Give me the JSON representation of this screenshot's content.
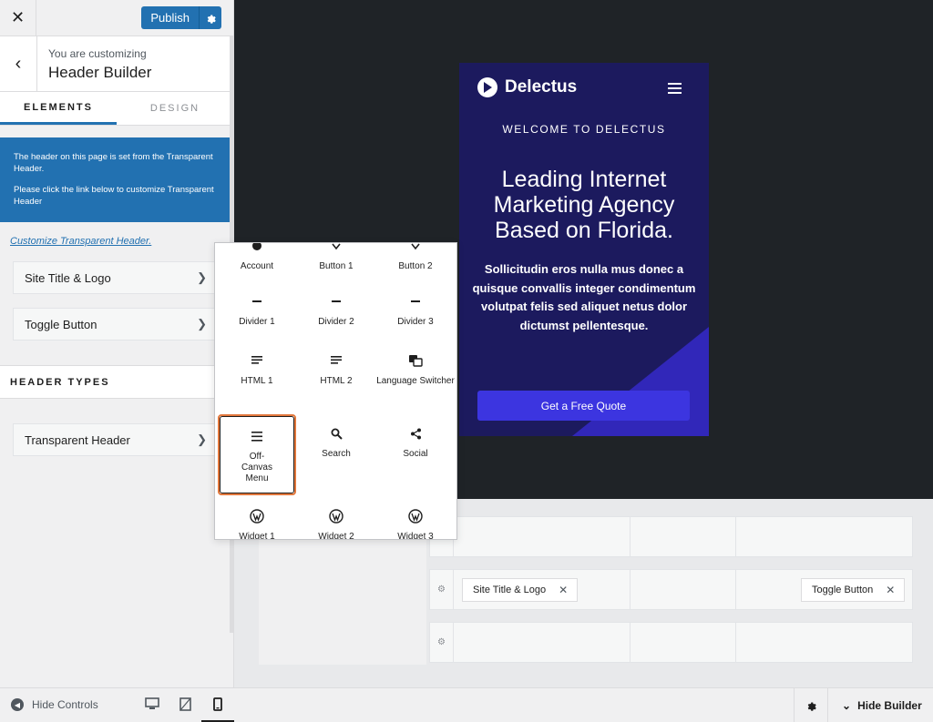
{
  "sidebar": {
    "publish_label": "Publish",
    "customizing_sub": "You are customizing",
    "customizing_title": "Header Builder",
    "tabs": [
      {
        "label": "ELEMENTS"
      },
      {
        "label": "DESIGN"
      }
    ],
    "notice_line1": "The header on this page is set from the Transparent Header.",
    "notice_line2": "Please click the link below to customize Transparent Header",
    "customize_link": "Customize Transparent Header.",
    "items": [
      {
        "label": "Site Title & Logo"
      },
      {
        "label": "Toggle Button"
      }
    ],
    "section_header_types": "HEADER TYPES",
    "header_type_items": [
      {
        "label": "Transparent Header"
      }
    ]
  },
  "bottombar": {
    "hide_controls": "Hide Controls",
    "hide_builder": "Hide Builder"
  },
  "preview": {
    "logo_text": "Delectus",
    "welcome": "WELCOME TO DELECTUS",
    "headline": "Leading Internet Marketing Agency Based on Florida.",
    "body": "Sollicitudin eros nulla mus donec a quisque convallis integer condimentum volutpat felis sed aliquet netus dolor dictumst pellentesque.",
    "cta": "Get a Free Quote"
  },
  "popup": {
    "items": [
      {
        "label": "Account",
        "icon": "account-icon"
      },
      {
        "label": "Button 1",
        "icon": "button-icon"
      },
      {
        "label": "Button 2",
        "icon": "button-icon"
      },
      {
        "label": "Divider 1",
        "icon": "divider-icon"
      },
      {
        "label": "Divider 2",
        "icon": "divider-icon"
      },
      {
        "label": "Divider 3",
        "icon": "divider-icon"
      },
      {
        "label": "HTML 1",
        "icon": "html-icon"
      },
      {
        "label": "HTML 2",
        "icon": "html-icon"
      },
      {
        "label": "Language Switcher",
        "icon": "translate-icon"
      },
      {
        "label": "Off-Canvas Menu",
        "icon": "menu-icon"
      },
      {
        "label": "Search",
        "icon": "search-icon"
      },
      {
        "label": "Social",
        "icon": "share-icon"
      },
      {
        "label": "Widget 1",
        "icon": "wordpress-icon"
      },
      {
        "label": "Widget 2",
        "icon": "wordpress-icon"
      },
      {
        "label": "Widget 3",
        "icon": "wordpress-icon"
      }
    ]
  },
  "builder": {
    "chips": [
      {
        "label": "Site Title & Logo"
      },
      {
        "label": "Toggle Button"
      }
    ]
  },
  "colors": {
    "accent": "#2271b1",
    "highlight": "#e2773c",
    "preview_bg": "#1c1a5e",
    "cta": "#3c35e0"
  }
}
